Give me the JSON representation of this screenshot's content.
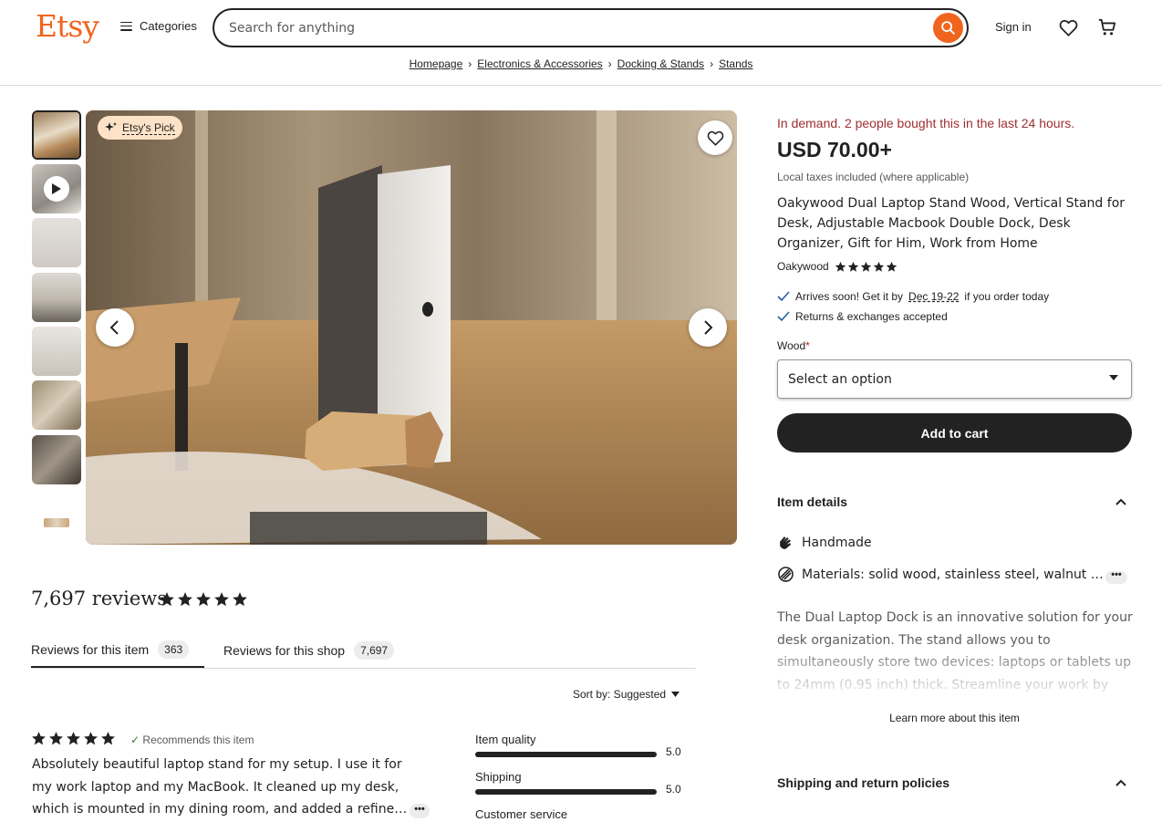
{
  "header": {
    "logo": "Etsy",
    "categories_label": "Categories",
    "search_placeholder": "Search for anything",
    "signin_label": "Sign in"
  },
  "breadcrumb": [
    "Homepage",
    "Electronics & Accessories",
    "Docking & Stands",
    "Stands"
  ],
  "gallery": {
    "badge": "Etsy's Pick",
    "thumbnails": [
      "thumb-1",
      "video-thumb",
      "thumb-3",
      "thumb-4",
      "thumb-5",
      "thumb-6",
      "thumb-7",
      "thumb-8"
    ]
  },
  "reviews": {
    "heading": "7,697 reviews",
    "tabs": [
      {
        "label": "Reviews for this item",
        "count": "363"
      },
      {
        "label": "Reviews for this shop",
        "count": "7,697"
      }
    ],
    "sort_label": "Sort by: Suggested",
    "first_review": {
      "recommends": "Recommends this item",
      "text": "Absolutely beautiful laptop stand for my setup. I use it for my work laptop and my MacBook. It cleaned up my desk, which is mounted in my dining room, and added a refine…"
    },
    "ratings": [
      {
        "label": "Item quality",
        "value": "5.0"
      },
      {
        "label": "Shipping",
        "value": "5.0"
      },
      {
        "label": "Customer service",
        "value": ""
      }
    ]
  },
  "product": {
    "demand": "In demand. 2 people bought this in the last 24 hours.",
    "price": "USD 70.00+",
    "taxes": "Local taxes included (where applicable)",
    "title": "Oakywood Dual Laptop Stand Wood, Vertical Stand for Desk, Adjustable Macbook Double Dock, Desk Organizer, Gift for Him, Work from Home",
    "shop": "Oakywood",
    "arrives_prefix": "Arrives soon! Get it by",
    "arrives_date": "Dec 19-22",
    "arrives_suffix": "if you order today",
    "returns": "Returns & exchanges accepted",
    "wood_label": "Wood",
    "wood_required": "*",
    "select_placeholder": "Select an option",
    "add_to_cart": "Add to cart",
    "item_details_title": "Item details",
    "handmade": "Handmade",
    "materials": "Materials: solid wood, stainless steel, walnut …",
    "description": "The Dual Laptop Dock is an innovative solution for your desk organization. The stand allows you to simultaneously store two devices: laptops or tablets up to 24mm (0.95 inch) thick. Streamline your work by",
    "learn_more": "Learn more about this item",
    "shipping_title": "Shipping and return policies"
  },
  "colors": {
    "brand": "#f1641e",
    "demand": "#9e2e2e",
    "dark": "#222222"
  }
}
